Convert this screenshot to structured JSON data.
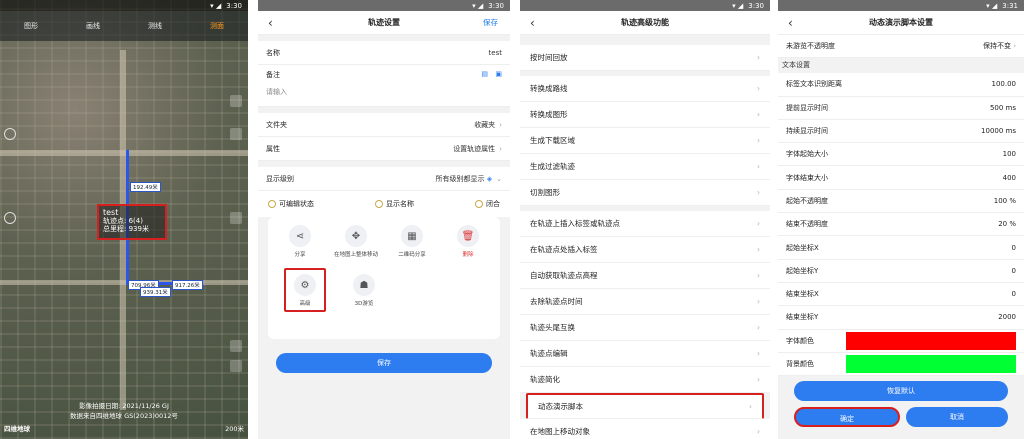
{
  "status": {
    "time1": "3:30",
    "time2": "3:30",
    "time3": "3:30",
    "time4": "3:31"
  },
  "map": {
    "tabs": [
      "图形",
      "画线",
      "测线",
      "测面"
    ],
    "route_labels": [
      "192.49米",
      "709.96米",
      "939.31米",
      "917.26米"
    ],
    "popup": {
      "name": "test",
      "points": "轨迹点: 6(4)",
      "length": "总里程: 939米"
    },
    "footer_date": "影像拍摄日期: 2021/11/26 GJ",
    "footer_source": "数据来自四维地球 GS(2023)0012号",
    "logo": "四维地球",
    "scale": "200米"
  },
  "p2": {
    "title": "轨迹设置",
    "save_top": "保存",
    "name_label": "名称",
    "name_value": "test",
    "note_label": "备注",
    "note_placeholder": "请输入",
    "folder_label": "文件夹",
    "folder_value": "收藏夹",
    "attr_label": "属性",
    "attr_value": "设置轨迹属性",
    "level_label": "显示级别",
    "level_value": "所有级别都显示",
    "radios": [
      "可编辑状态",
      "显示名称",
      "闭合"
    ],
    "actions": [
      "分享",
      "在地图上整体移动",
      "二维码分享",
      "删除",
      "高级",
      "3D游览"
    ],
    "save_btn": "保存"
  },
  "p3": {
    "title": "轨迹高级功能",
    "groups": [
      [
        "按时间回放"
      ],
      [
        "转换成路线",
        "转换成图形",
        "生成下载区域",
        "生成过滤轨迹",
        "切割图形"
      ],
      [
        "在轨迹上插入标签或轨迹点",
        "在轨迹点处插入标签",
        "自动获取轨迹点高程",
        "去除轨迹点时间",
        "轨迹头尾互换",
        "轨迹点编辑",
        "轨迹简化",
        "动态演示脚本",
        "在地图上移动对象"
      ]
    ]
  },
  "p4": {
    "title": "动态演示脚本设置",
    "top_label": "未游览不透明度",
    "top_value": "保持不变",
    "section": "文本设置",
    "rows": [
      [
        "标签文本识别距离",
        "100.00"
      ],
      [
        "提前显示时间",
        "500 ms"
      ],
      [
        "持续显示时间",
        "10000 ms"
      ],
      [
        "字体起始大小",
        "100"
      ],
      [
        "字体结束大小",
        "400"
      ],
      [
        "起始不透明度",
        "100 %"
      ],
      [
        "结束不透明度",
        "20 %"
      ],
      [
        "起始坐标X",
        "0"
      ],
      [
        "起始坐标Y",
        "0"
      ],
      [
        "结束坐标X",
        "0"
      ],
      [
        "结束坐标Y",
        "2000"
      ]
    ],
    "font_color_label": "字体颜色",
    "font_color": "#ff0000",
    "bg_color_label": "背景颜色",
    "bg_color": "#00ff33",
    "reset_btn": "恢复默认",
    "ok_btn": "确定",
    "cancel_btn": "取消"
  }
}
